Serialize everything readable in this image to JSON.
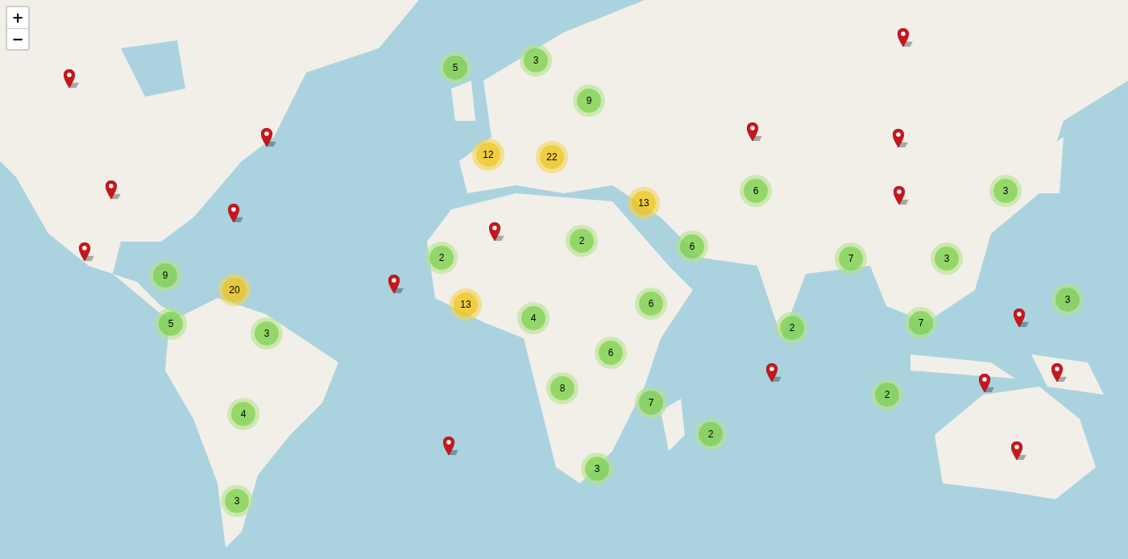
{
  "zoom_controls": [
    {
      "label": "+"
    },
    {
      "label": "−"
    }
  ],
  "clusters": [
    {
      "count": "5",
      "kind": "small"
    },
    {
      "count": "3",
      "kind": "small"
    },
    {
      "count": "9",
      "kind": "small"
    },
    {
      "count": "12",
      "kind": "medium"
    },
    {
      "count": "22",
      "kind": "medium"
    },
    {
      "count": "13",
      "kind": "medium"
    },
    {
      "count": "6",
      "kind": "small"
    },
    {
      "count": "3",
      "kind": "small"
    },
    {
      "count": "2",
      "kind": "small"
    },
    {
      "count": "6",
      "kind": "small"
    },
    {
      "count": "2",
      "kind": "small"
    },
    {
      "count": "9",
      "kind": "small"
    },
    {
      "count": "20",
      "kind": "medium"
    },
    {
      "count": "7",
      "kind": "small"
    },
    {
      "count": "3",
      "kind": "small"
    },
    {
      "count": "3",
      "kind": "small"
    },
    {
      "count": "13",
      "kind": "medium"
    },
    {
      "count": "6",
      "kind": "small"
    },
    {
      "count": "4",
      "kind": "small"
    },
    {
      "count": "5",
      "kind": "small"
    },
    {
      "count": "3",
      "kind": "small"
    },
    {
      "count": "2",
      "kind": "small"
    },
    {
      "count": "7",
      "kind": "small"
    },
    {
      "count": "6",
      "kind": "small"
    },
    {
      "count": "8",
      "kind": "small"
    },
    {
      "count": "7",
      "kind": "small"
    },
    {
      "count": "2",
      "kind": "small"
    },
    {
      "count": "4",
      "kind": "small"
    },
    {
      "count": "2",
      "kind": "small"
    },
    {
      "count": "3",
      "kind": "small"
    },
    {
      "count": "3",
      "kind": "small"
    }
  ]
}
